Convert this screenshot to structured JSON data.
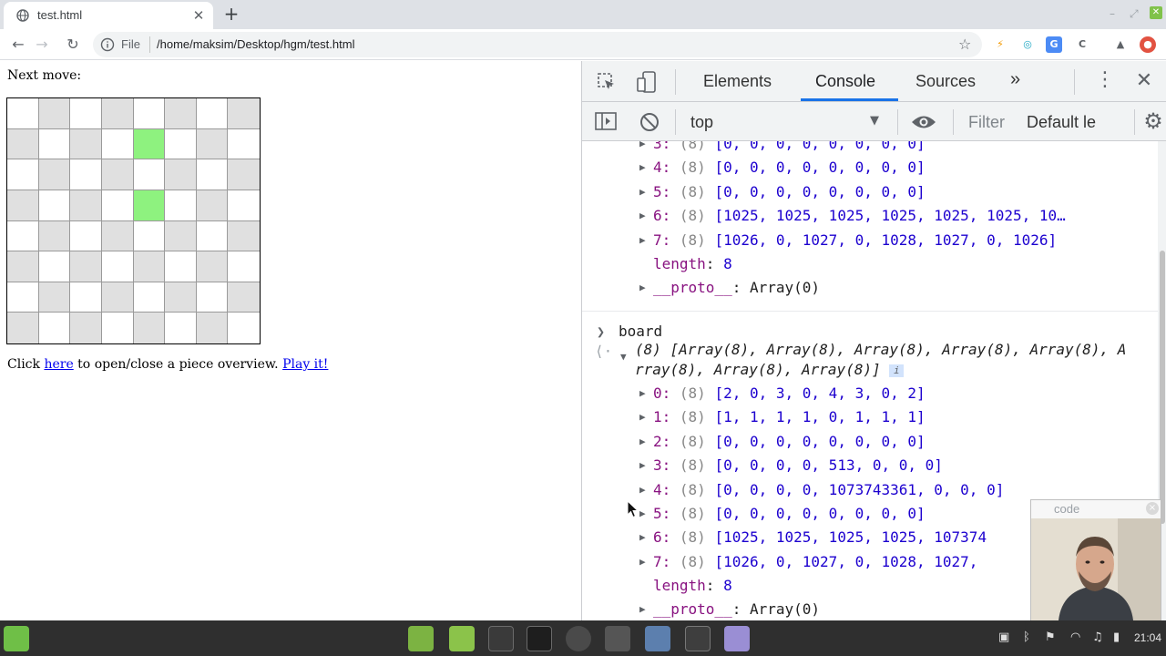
{
  "browser": {
    "tab_title": "test.html",
    "tab_close": "✕",
    "new_tab": "+",
    "scheme_label": "File",
    "url": "/home/maksim/Desktop/hgm/test.html"
  },
  "page": {
    "next_move_label": "Next move:",
    "board": {
      "rows": 8,
      "cols": 8,
      "highlighted_cells": [
        [
          1,
          4
        ],
        [
          3,
          4
        ]
      ]
    },
    "footer": {
      "prefix": "Click ",
      "link1": "here",
      "middle": " to open/close a piece overview. ",
      "link2": "Play it!"
    }
  },
  "devtools": {
    "tabs": [
      "Elements",
      "Console",
      "Sources"
    ],
    "more_tabs": "»",
    "context": "top",
    "filter_placeholder": "Filter",
    "levels": "Default le",
    "console_rows_prev": [
      {
        "key": "3:",
        "count": "(8)",
        "values": "[0, 0, 0, 0, 0, 0, 0, 0]"
      },
      {
        "key": "4:",
        "count": "(8)",
        "values": "[0, 0, 0, 0, 0, 0, 0, 0]"
      },
      {
        "key": "5:",
        "count": "(8)",
        "values": "[0, 0, 0, 0, 0, 0, 0, 0]"
      },
      {
        "key": "6:",
        "count": "(8)",
        "values": "[1025, 1025, 1025, 1025, 1025, 1025, 10…"
      },
      {
        "key": "7:",
        "count": "(8)",
        "values": "[1026, 0, 1027, 0, 1028, 1027, 0, 1026]"
      }
    ],
    "length_label": "length",
    "length_value": "8",
    "proto_label": "__proto__",
    "proto_value": "Array(0)",
    "command": "board",
    "result_header": "(8) [Array(8), Array(8), Array(8), Array(8), Array(8), Array(8), Array(8), Array(8)]",
    "info_badge": "i",
    "console_rows_board": [
      {
        "key": "0:",
        "count": "(8)",
        "values": "[2, 0, 3, 0, 4, 3, 0, 2]"
      },
      {
        "key": "1:",
        "count": "(8)",
        "values": "[1, 1, 1, 1, 0, 1, 1, 1]"
      },
      {
        "key": "2:",
        "count": "(8)",
        "values": "[0, 0, 0, 0, 0, 0, 0, 0]"
      },
      {
        "key": "3:",
        "count": "(8)",
        "values": "[0, 0, 0, 0, 513, 0, 0, 0]"
      },
      {
        "key": "4:",
        "count": "(8)",
        "values": "[0, 0, 0, 0, 1073743361, 0, 0, 0]"
      },
      {
        "key": "5:",
        "count": "(8)",
        "values": "[0, 0, 0, 0, 0, 0, 0, 0]"
      },
      {
        "key": "6:",
        "count": "(8)",
        "values": "[1025, 1025, 1025, 1025, 107374"
      },
      {
        "key": "7:",
        "count": "(8)",
        "values": "[1026, 0, 1027, 0, 1028, 1027, "
      }
    ]
  },
  "webcam": {
    "title": "code",
    "close": "×"
  },
  "taskbar": {
    "clock": "21:04"
  },
  "colors": {
    "board_highlight": "#8ef27f",
    "board_dark": "#e0e0e0",
    "accent": "#1a73e8"
  }
}
